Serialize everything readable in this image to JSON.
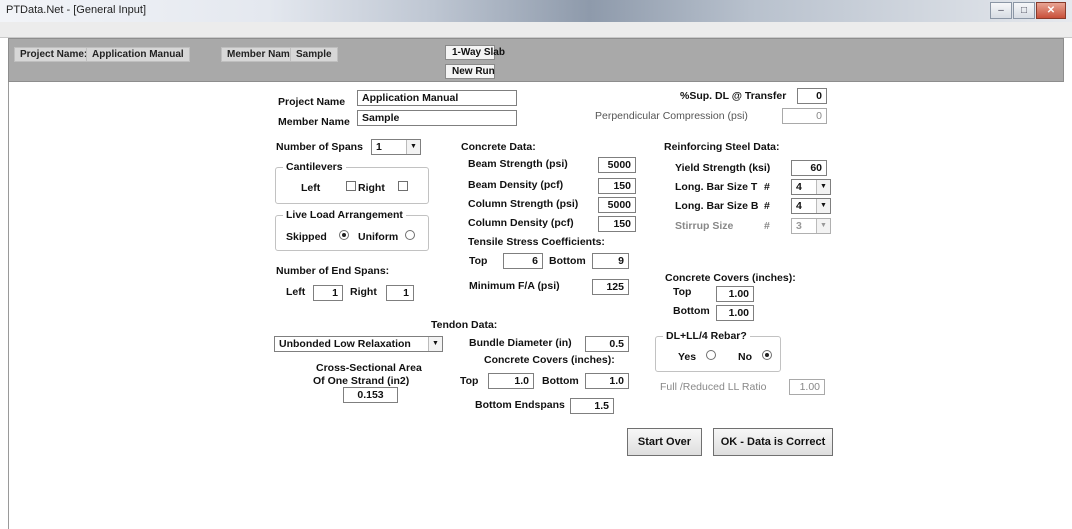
{
  "window": {
    "title": "PTData.Net - [General Input]"
  },
  "header": {
    "project_name_label": "Project Name:",
    "project_name_value": "Application Manual",
    "member_name_label": "Member Name:",
    "member_name_value": "Sample",
    "slab_type_button": "1-Way Slab",
    "new_run_button": "New Run"
  },
  "form": {
    "project_name_label": "Project Name",
    "project_name_value": "Application Manual",
    "member_name_label": "Member Name",
    "member_name_value": "Sample",
    "sup_dl_label": "%Sup. DL @ Transfer",
    "sup_dl_value": "0",
    "perp_comp_label": "Perpendicular Compression (psi)",
    "perp_comp_value": "0"
  },
  "spans": {
    "number_label": "Number of Spans",
    "number_value": "1",
    "cantilevers_title": "Cantilevers",
    "left_label": "Left",
    "right_label": "Right",
    "live_load_title": "Live Load Arrangement",
    "skipped_label": "Skipped",
    "uniform_label": "Uniform",
    "end_spans_label": "Number of End Spans:",
    "end_left_label": "Left",
    "end_left_value": "1",
    "end_right_label": "Right",
    "end_right_value": "1"
  },
  "concrete": {
    "title": "Concrete Data:",
    "beam_strength_label": "Beam Strength (psi)",
    "beam_strength_value": "5000",
    "beam_density_label": "Beam Density (pcf)",
    "beam_density_value": "150",
    "column_strength_label": "Column Strength (psi)",
    "column_strength_value": "5000",
    "column_density_label": "Column Density (pcf)",
    "column_density_value": "150",
    "tensile_title": "Tensile Stress Coefficients:",
    "top_label": "Top",
    "top_value": "6",
    "bottom_label": "Bottom",
    "bottom_value": "9",
    "min_fa_label": "Minimum F/A (psi)",
    "min_fa_value": "125"
  },
  "steel": {
    "title": "Reinforcing Steel Data:",
    "yield_label": "Yield Strength (ksi)",
    "yield_value": "60",
    "long_t_label": "Long. Bar Size T",
    "long_t_value": "4",
    "long_b_label": "Long. Bar Size B",
    "long_b_value": "4",
    "stirrup_label": "Stirrup Size",
    "stirrup_value": "3",
    "hash": "#",
    "covers_title": "Concrete Covers (inches):",
    "cover_top_label": "Top",
    "cover_top_value": "1.00",
    "cover_bottom_label": "Bottom",
    "cover_bottom_value": "1.00",
    "rebar_title": "DL+LL/4 Rebar?",
    "yes_label": "Yes",
    "no_label": "No",
    "ratio_label": "Full /Reduced LL Ratio",
    "ratio_value": "1.00"
  },
  "tendon": {
    "title": "Tendon Data:",
    "type_value": "Unbonded Low Relaxation",
    "area_label_1": "Cross-Sectional Area",
    "area_label_2": "Of One Strand (in2)",
    "area_value": "0.153",
    "bundle_label": "Bundle Diameter (in)",
    "bundle_value": "0.5",
    "covers_title": "Concrete Covers (inches):",
    "top_label": "Top",
    "top_value": "1.0",
    "bottom_label": "Bottom",
    "bottom_value": "1.0",
    "bottom_endspans_label": "Bottom Endspans",
    "bottom_endspans_value": "1.5"
  },
  "actions": {
    "start_over": "Start Over",
    "ok": "OK - Data is Correct"
  },
  "icons": {
    "minimize": "minimize-icon",
    "maximize": "maximize-icon",
    "close": "close-icon",
    "dropdown": "chevron-down-icon"
  }
}
